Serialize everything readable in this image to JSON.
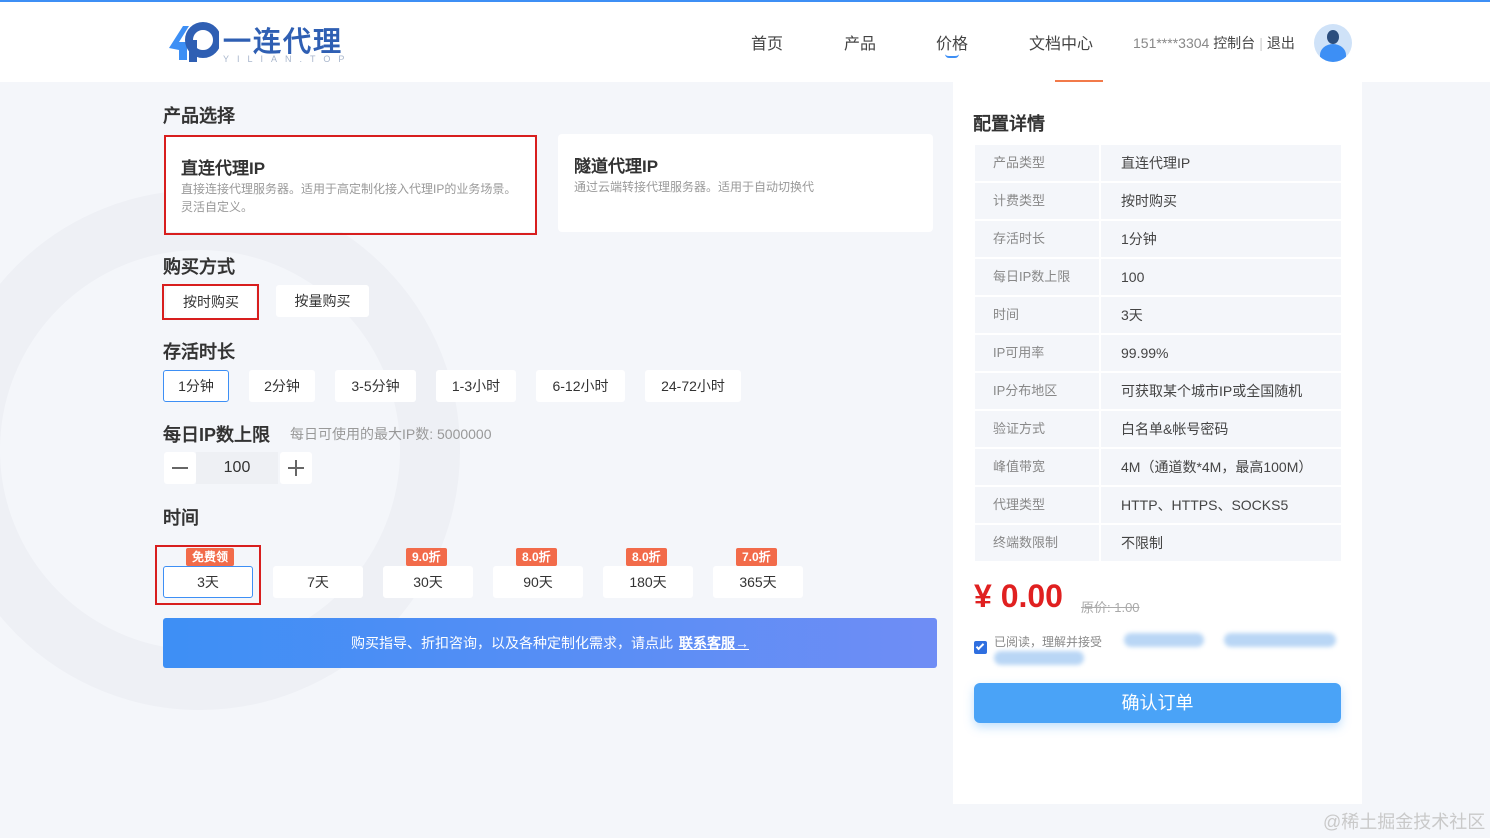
{
  "header": {
    "logo_text": "一连代理",
    "logo_sub": "YILIAN.TOP",
    "nav": [
      "首页",
      "产品",
      "价格",
      "文档中心"
    ],
    "user_phone": "151****3304",
    "console": "控制台",
    "logout": "退出"
  },
  "product": {
    "title": "产品选择",
    "options": [
      {
        "name": "直连代理IP",
        "desc1": "直接连接代理服务器。适用于高定制化接入代理IP的业务场景。",
        "desc2": "灵活自定义。"
      },
      {
        "name": "隧道代理IP",
        "desc1": "通过云端转接代理服务器。适用于自动切换代",
        "desc2": ""
      }
    ]
  },
  "purchase": {
    "title": "购买方式",
    "options": [
      "按时购买",
      "按量购买"
    ]
  },
  "lifetime": {
    "title": "存活时长",
    "options": [
      "1分钟",
      "2分钟",
      "3-5分钟",
      "1-3小时",
      "6-12小时",
      "24-72小时"
    ]
  },
  "daily_ip": {
    "title": "每日IP数上限",
    "hint": "每日可使用的最大IP数: 5000000",
    "value": "100"
  },
  "duration": {
    "title": "时间",
    "options": [
      {
        "label": "3天",
        "badge": "免费领"
      },
      {
        "label": "7天",
        "badge": ""
      },
      {
        "label": "30天",
        "badge": "9.0折"
      },
      {
        "label": "90天",
        "badge": "8.0折"
      },
      {
        "label": "180天",
        "badge": "8.0折"
      },
      {
        "label": "365天",
        "badge": "7.0折"
      }
    ]
  },
  "banner": {
    "text": "购买指导、折扣咨询，以及各种定制化需求，请点此",
    "link": "联系客服",
    "arrow": "→"
  },
  "config": {
    "title": "配置详情",
    "rows": [
      {
        "k": "产品类型",
        "v": "直连代理IP"
      },
      {
        "k": "计费类型",
        "v": "按时购买"
      },
      {
        "k": "存活时长",
        "v": "1分钟"
      },
      {
        "k": "每日IP数上限",
        "v": "100"
      },
      {
        "k": "时间",
        "v": "3天"
      },
      {
        "k": "IP可用率",
        "v": "99.99%"
      },
      {
        "k": "IP分布地区",
        "v": "可获取某个城市IP或全国随机"
      },
      {
        "k": "验证方式",
        "v": "白名单&帐号密码"
      },
      {
        "k": "峰值带宽",
        "v": "4M（通道数*4M，最高100M）"
      },
      {
        "k": "代理类型",
        "v": "HTTP、HTTPS、SOCKS5"
      },
      {
        "k": "终端数限制",
        "v": "不限制"
      }
    ],
    "price": "¥ 0.00",
    "original_price": "原价: 1.00",
    "agree_text": "已阅读，理解并接受",
    "confirm": "确认订单"
  },
  "watermark": "@稀土掘金技术社区",
  "colors": {
    "accent": "#3d8ff5",
    "price": "#e02020",
    "badge": "#f26b4a",
    "highlight_box": "#d81e1e"
  }
}
